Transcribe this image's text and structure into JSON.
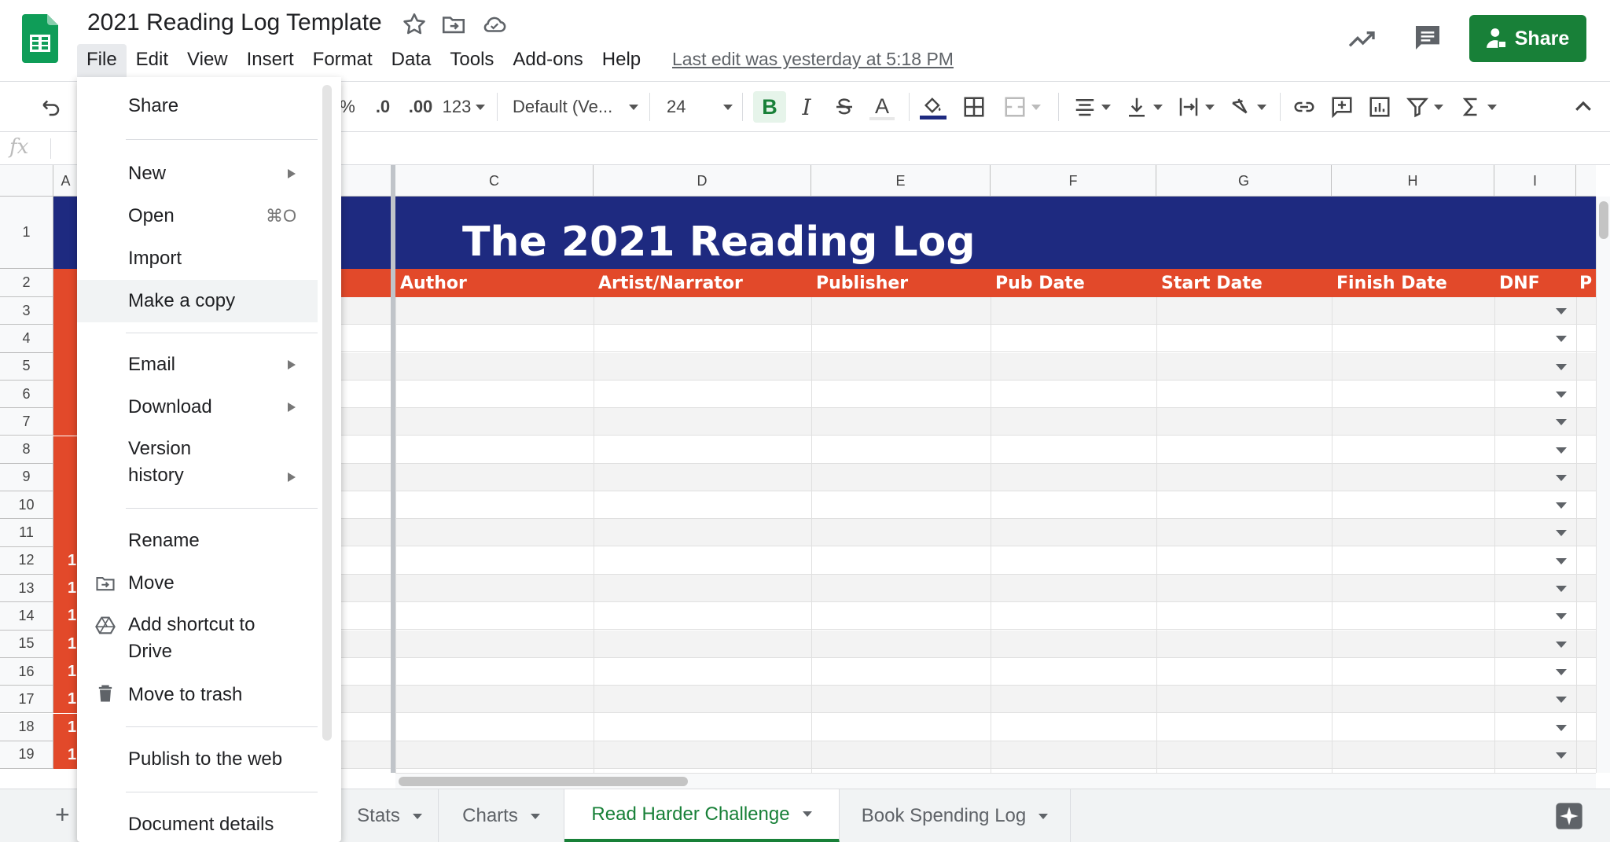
{
  "app": {
    "title": "2021 Reading Log Template",
    "last_edit": "Last edit was yesterday at 5:18 PM",
    "share_label": "Share",
    "menus": [
      "File",
      "Edit",
      "View",
      "Insert",
      "Format",
      "Data",
      "Tools",
      "Add-ons",
      "Help"
    ],
    "active_menu": "File"
  },
  "toolbar": {
    "percent": "%",
    "decrease_decimal": ".0",
    "increase_decimal": ".00",
    "number_format": "123",
    "font": "Default (Ve...",
    "font_size": "24",
    "bold": "B",
    "italic": "I",
    "text_color": "A"
  },
  "formula_bar": {
    "fx": "fx"
  },
  "file_menu": {
    "items": [
      {
        "label": "Share"
      },
      {
        "label": "New",
        "submenu": true
      },
      {
        "label": "Open",
        "shortcut": "⌘O"
      },
      {
        "label": "Import"
      },
      {
        "label": "Make a copy",
        "highlighted": true
      },
      {
        "label": "Email",
        "submenu": true
      },
      {
        "label": "Download",
        "submenu": true
      },
      {
        "label": "Version",
        "label2": "history",
        "submenu": true
      },
      {
        "label": "Rename"
      },
      {
        "label": "Move",
        "icon": "folder-move-icon"
      },
      {
        "label": "Add shortcut to",
        "label2": "Drive",
        "icon": "drive-shortcut-icon"
      },
      {
        "label": "Move to trash",
        "icon": "trash-icon"
      },
      {
        "label": "Publish to the web"
      },
      {
        "label": "Document details"
      }
    ]
  },
  "sheet": {
    "col_headers": [
      "A",
      "C",
      "D",
      "E",
      "F",
      "G",
      "H",
      "I"
    ],
    "row_headers": [
      "1",
      "2",
      "3",
      "4",
      "5",
      "6",
      "7",
      "8",
      "9",
      "10",
      "11",
      "12",
      "13",
      "14",
      "15",
      "16",
      "17",
      "18",
      "19"
    ],
    "title_text": "The 2021 Reading Log",
    "header_cells": [
      "Author",
      "Artist/Narrator",
      "Publisher",
      "Pub Date",
      "Start Date",
      "Finish Date",
      "DNF",
      "P"
    ],
    "col_a_values": [
      "1",
      "1",
      "1",
      "1",
      "1",
      "1",
      "1",
      "1"
    ]
  },
  "sheet_tabs": {
    "add_label": "+",
    "tabs": [
      {
        "label": "Stats"
      },
      {
        "label": "Charts"
      },
      {
        "label": "Read Harder Challenge",
        "active": true
      },
      {
        "label": "Book Spending Log"
      }
    ]
  },
  "colors": {
    "brand_green": "#188038",
    "title_band": "#1e2a80",
    "header_band": "#e2492a"
  }
}
